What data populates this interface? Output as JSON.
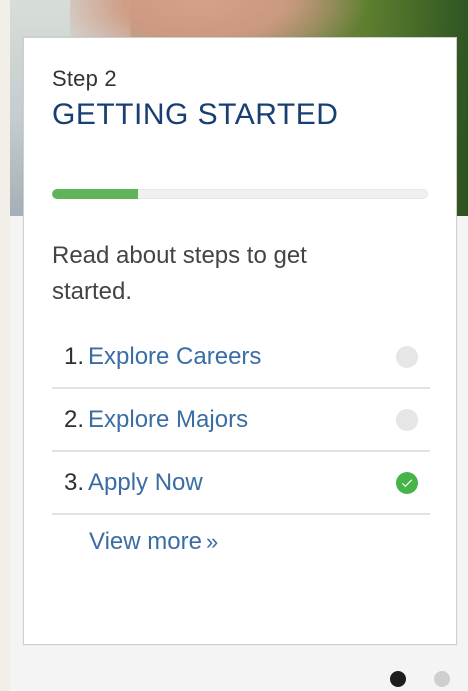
{
  "card": {
    "step_label": "Step 2",
    "title": "GETTING STARTED",
    "progress_percent": 23,
    "description": "Read about steps to get started.",
    "steps": [
      {
        "number": "1.",
        "label": "Explore Careers",
        "status": "pending"
      },
      {
        "number": "2.",
        "label": "Explore Majors",
        "status": "pending"
      },
      {
        "number": "3.",
        "label": "Apply Now",
        "status": "done"
      }
    ],
    "view_more_label": "View more",
    "view_more_icon": "chevron-double-right-icon"
  },
  "pagination": {
    "active_index": 0,
    "total": 2
  },
  "colors": {
    "title": "#173f73",
    "link": "#3b6da5",
    "progress": "#5fb45a",
    "done": "#47b44a",
    "pending": "#e6e6e6",
    "dot_active": "#1d1d1d",
    "dot_inactive": "#cfcfcf"
  }
}
